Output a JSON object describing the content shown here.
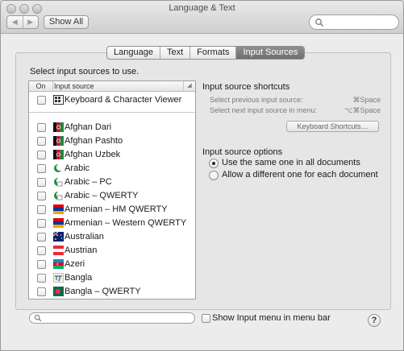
{
  "window": {
    "title": "Language & Text"
  },
  "toolbar": {
    "back_glyph": "◀",
    "forward_glyph": "▶",
    "show_all_label": "Show All",
    "search_placeholder": ""
  },
  "tabs": [
    {
      "label": "Language",
      "selected": false
    },
    {
      "label": "Text",
      "selected": false
    },
    {
      "label": "Formats",
      "selected": false
    },
    {
      "label": "Input Sources",
      "selected": true
    }
  ],
  "main": {
    "select_label": "Select input sources to use.",
    "list_header": {
      "on": "On",
      "source": "Input source"
    },
    "items": [
      {
        "label": "Keyboard & Character Viewer",
        "icon": "keyboard-viewer-icon",
        "checked": false
      },
      {
        "label": "Afghan Dari",
        "icon": "afghanistan-flag-icon",
        "checked": false
      },
      {
        "label": "Afghan Pashto",
        "icon": "afghanistan-flag-icon",
        "checked": false
      },
      {
        "label": "Afghan Uzbek",
        "icon": "afghanistan-flag-icon",
        "checked": false
      },
      {
        "label": "Arabic",
        "icon": "crescent-icon",
        "checked": false
      },
      {
        "label": "Arabic – PC",
        "icon": "crescent-icon",
        "checked": false
      },
      {
        "label": "Arabic – QWERTY",
        "icon": "crescent-icon",
        "checked": false
      },
      {
        "label": "Armenian – HM QWERTY",
        "icon": "armenia-flag-icon",
        "checked": false
      },
      {
        "label": "Armenian – Western QWERTY",
        "icon": "armenia-flag-icon",
        "checked": false
      },
      {
        "label": "Australian",
        "icon": "australia-flag-icon",
        "checked": false
      },
      {
        "label": "Austrian",
        "icon": "austria-flag-icon",
        "checked": false
      },
      {
        "label": "Azeri",
        "icon": "azerbaijan-flag-icon",
        "checked": false
      },
      {
        "label": "Bangla",
        "icon": "bangla-script-icon",
        "checked": false
      },
      {
        "label": "Bangla – QWERTY",
        "icon": "bangladesh-flag-icon",
        "checked": false
      }
    ],
    "bottom_search_placeholder": ""
  },
  "shortcuts": {
    "heading": "Input source shortcuts",
    "prev_label": "Select previous input source:",
    "prev_key": "⌘Space",
    "next_label": "Select next input source in menu:",
    "next_key": "⌥⌘Space",
    "button_label": "Keyboard Shortcuts…"
  },
  "options": {
    "heading": "Input source options",
    "same_label": "Use the same one in all documents",
    "different_label": "Allow a different one for each document",
    "selected": "same"
  },
  "footer": {
    "show_menu_label": "Show Input menu in menu bar",
    "show_menu_checked": false,
    "help_label": "?"
  }
}
